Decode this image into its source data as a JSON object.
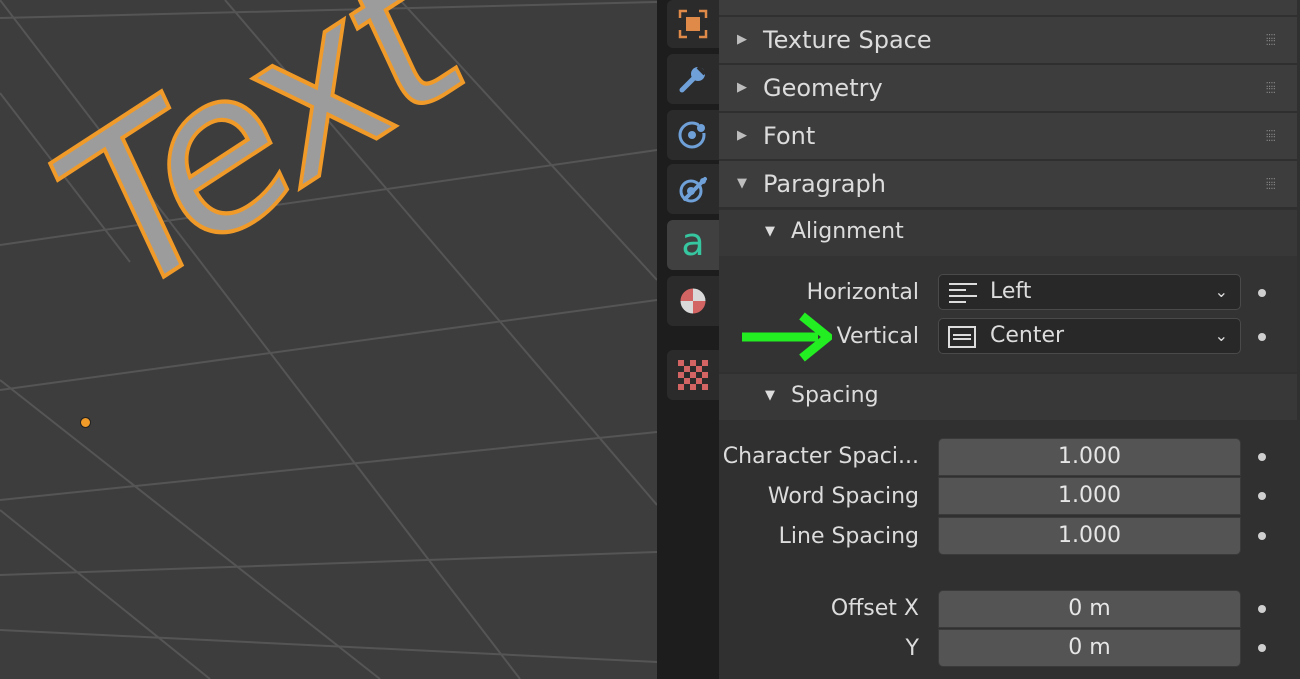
{
  "viewport": {
    "text_object": "Text"
  },
  "tabs": [
    {
      "icon": "texture-space-icon"
    },
    {
      "icon": "wrench-icon"
    },
    {
      "icon": "physics-icon"
    },
    {
      "icon": "constraints-icon"
    },
    {
      "icon": "text-data-icon",
      "active": true
    },
    {
      "icon": "material-icon"
    },
    {
      "icon": "checker-texture-icon"
    }
  ],
  "panel": {
    "sections": {
      "texture_space": "Texture Space",
      "geometry": "Geometry",
      "font": "Font",
      "paragraph": "Paragraph"
    },
    "alignment": {
      "title": "Alignment",
      "horizontal_label": "Horizontal",
      "horizontal_value": "Left",
      "vertical_label": "Vertical",
      "vertical_value": "Center"
    },
    "spacing": {
      "title": "Spacing",
      "character_label": "Character Spaci...",
      "character_value": "1.000",
      "word_label": "Word Spacing",
      "word_value": "1.000",
      "line_label": "Line Spacing",
      "line_value": "1.000",
      "offset_x_label": "Offset X",
      "offset_x_value": "0 m",
      "offset_y_label": "Y",
      "offset_y_value": "0 m"
    }
  },
  "colors": {
    "accent_orange": "#f09a2a",
    "arrow_green": "#22ee22",
    "text_teal": "#36c6a0"
  }
}
